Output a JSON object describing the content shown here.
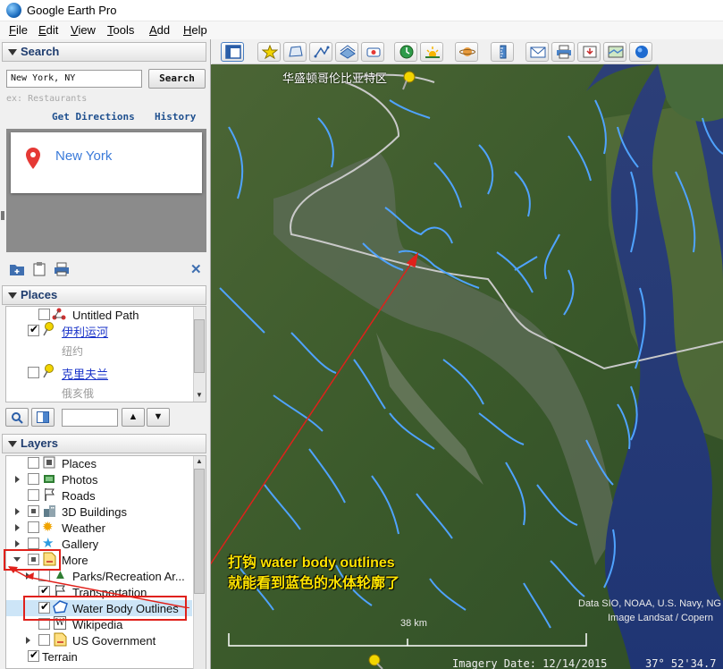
{
  "window": {
    "title": "Google Earth Pro"
  },
  "menu": [
    "File",
    "Edit",
    "View",
    "Tools",
    "Add",
    "Help"
  ],
  "search": {
    "header": "Search",
    "input_value": "New York, NY",
    "button": "Search",
    "hint": "ex: Restaurants",
    "get_directions": "Get Directions",
    "history": "History",
    "result_title": "New York"
  },
  "places": {
    "header": "Places",
    "items": [
      {
        "label": "Untitled Path",
        "checked": false
      },
      {
        "label": "伊利运河",
        "sub": "纽约",
        "checked": true
      },
      {
        "label": "克里夫兰",
        "sub": "俄亥俄",
        "checked": false
      }
    ]
  },
  "layers": {
    "header": "Layers",
    "items": [
      {
        "label": "Places"
      },
      {
        "label": "Photos"
      },
      {
        "label": "Roads"
      },
      {
        "label": "3D Buildings"
      },
      {
        "label": "Weather"
      },
      {
        "label": "Gallery"
      },
      {
        "label": "More"
      },
      {
        "label": "Parks/Recreation Ar..."
      },
      {
        "label": "Transportation"
      },
      {
        "label": "Water Body Outlines"
      },
      {
        "label": "Wikipedia"
      },
      {
        "label": "US Government"
      },
      {
        "label": "Terrain"
      }
    ]
  },
  "map": {
    "placemark_label": "华盛顿哥伦比亚特区",
    "annotation_line1": "打钩 water body outlines",
    "annotation_line2": "就能看到蓝色的水体轮廓了",
    "attribution_line1": "Data SIO, NOAA, U.S. Navy, NG",
    "attribution_line2": "Image Landsat / Copern",
    "scale_label": "38 km",
    "status_imagery": "Imagery Date: 12/14/2015",
    "status_coords": "37° 52'34.7",
    "annotation_color": "#e0211b",
    "water_outline_color": "#4fa3ff"
  }
}
